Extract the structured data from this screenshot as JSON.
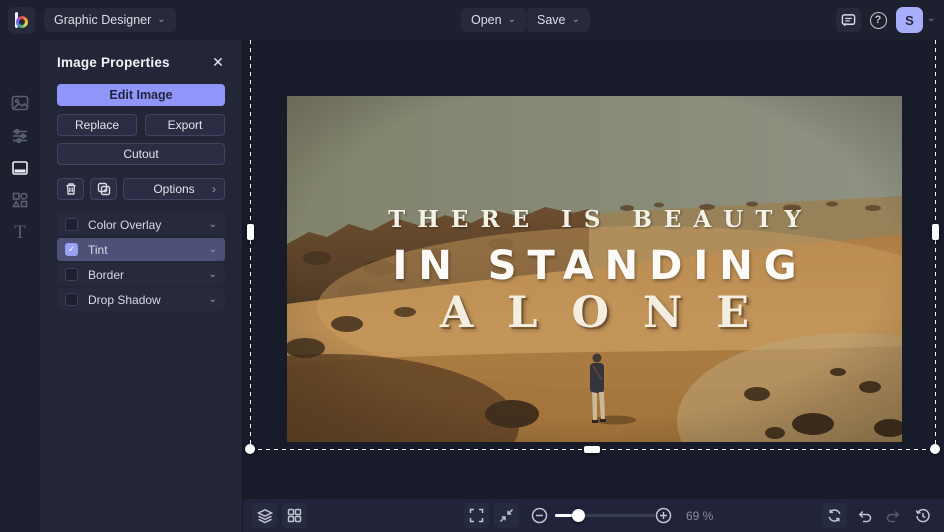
{
  "topbar": {
    "app_menu": "Graphic Designer",
    "open": "Open",
    "save": "Save",
    "avatar_initial": "S"
  },
  "panel": {
    "title": "Image Properties",
    "edit_image": "Edit Image",
    "replace": "Replace",
    "export": "Export",
    "cutout": "Cutout",
    "options": "Options",
    "properties": [
      {
        "label": "Color Overlay",
        "checked": false
      },
      {
        "label": "Tint",
        "checked": true
      },
      {
        "label": "Border",
        "checked": false
      },
      {
        "label": "Drop Shadow",
        "checked": false
      }
    ]
  },
  "canvas": {
    "overlay_text": {
      "line1": "THERE IS BEAUTY",
      "line2": "IN STANDING",
      "line3": "ALONE"
    }
  },
  "bottombar": {
    "zoom_level": "69 %"
  },
  "glyphs": {
    "chevron_down": "⌄",
    "chevron_right": "›",
    "close": "✕",
    "question": "?",
    "check": "✓"
  },
  "colors": {
    "accent": "#8f95f9",
    "selected_row": "#4d5077",
    "topbar_bg": "#1d202e",
    "panel_bg": "#232637",
    "canvas_bg": "#181b29"
  }
}
